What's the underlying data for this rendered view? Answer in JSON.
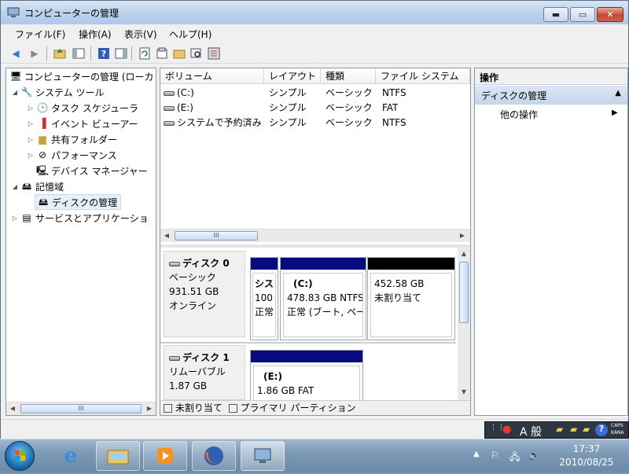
{
  "window": {
    "title": "コンピューターの管理",
    "controls": {
      "min": "▬",
      "max": "▭",
      "close": "✕"
    }
  },
  "menu": [
    "ファイル(F)",
    "操作(A)",
    "表示(V)",
    "ヘルプ(H)"
  ],
  "tree": {
    "items": [
      {
        "label": "コンピューターの管理 (ローカ",
        "icon": "computer-icon"
      },
      {
        "label": "システム ツール",
        "icon": "tools-icon"
      },
      {
        "label": "タスク スケジューラ",
        "icon": "clock-icon"
      },
      {
        "label": "イベント ビューアー",
        "icon": "event-viewer-icon"
      },
      {
        "label": "共有フォルダー",
        "icon": "shared-folder-icon"
      },
      {
        "label": "パフォーマンス",
        "icon": "performance-icon"
      },
      {
        "label": "デバイス マネージャー",
        "icon": "device-manager-icon"
      },
      {
        "label": "記憶域",
        "icon": "storage-icon"
      },
      {
        "label": "ディスクの管理",
        "icon": "disk-management-icon"
      },
      {
        "label": "サービスとアプリケーショ",
        "icon": "services-icon"
      }
    ],
    "scroll_thumb": "III"
  },
  "volumes": {
    "columns": [
      "ボリューム",
      "レイアウト",
      "種類",
      "ファイル システム"
    ],
    "rows": [
      {
        "name": "(C:)",
        "layout": "シンプル",
        "type": "ベーシック",
        "fs": "NTFS"
      },
      {
        "name": "(E:)",
        "layout": "シンプル",
        "type": "ベーシック",
        "fs": "FAT"
      },
      {
        "name": "システムで予約済み",
        "layout": "シンプル",
        "type": "ベーシック",
        "fs": "NTFS"
      }
    ],
    "scroll_thumb": "III"
  },
  "disks": [
    {
      "title": "ディスク 0",
      "kind": "ベーシック",
      "size": "931.51 GB",
      "status": "オンライン",
      "partitions": [
        {
          "line1": "シス",
          "line2": "100",
          "line3": "正常",
          "color": "#0a0a80"
        },
        {
          "line1": "(C:)",
          "line2": "478.83 GB NTFS",
          "line3": "正常 (ブート, ペー",
          "color": "#0a0a80"
        },
        {
          "line1": "",
          "line2": "452.58 GB",
          "line3": "未割り当て",
          "color": "#000000"
        }
      ]
    },
    {
      "title": "ディスク 1",
      "kind": "リムーバブル",
      "size": "1.87 GB",
      "status": "",
      "partitions": [
        {
          "line1": "(E:)",
          "line2": "1.86 GB FAT",
          "line3": "",
          "color": "#0a0a80"
        }
      ]
    }
  ],
  "legend": [
    {
      "label": "未割り当て",
      "color": "#000000"
    },
    {
      "label": "プライマリ パーティション",
      "color": "#0a0a80"
    }
  ],
  "actions": {
    "header": "操作",
    "section": "ディスクの管理",
    "item": "他の操作"
  },
  "langbar": {
    "ime": "A 般",
    "caps": "CAPS",
    "kana": "KANA"
  },
  "clock": {
    "time": "17:37",
    "date": "2010/08/25"
  }
}
